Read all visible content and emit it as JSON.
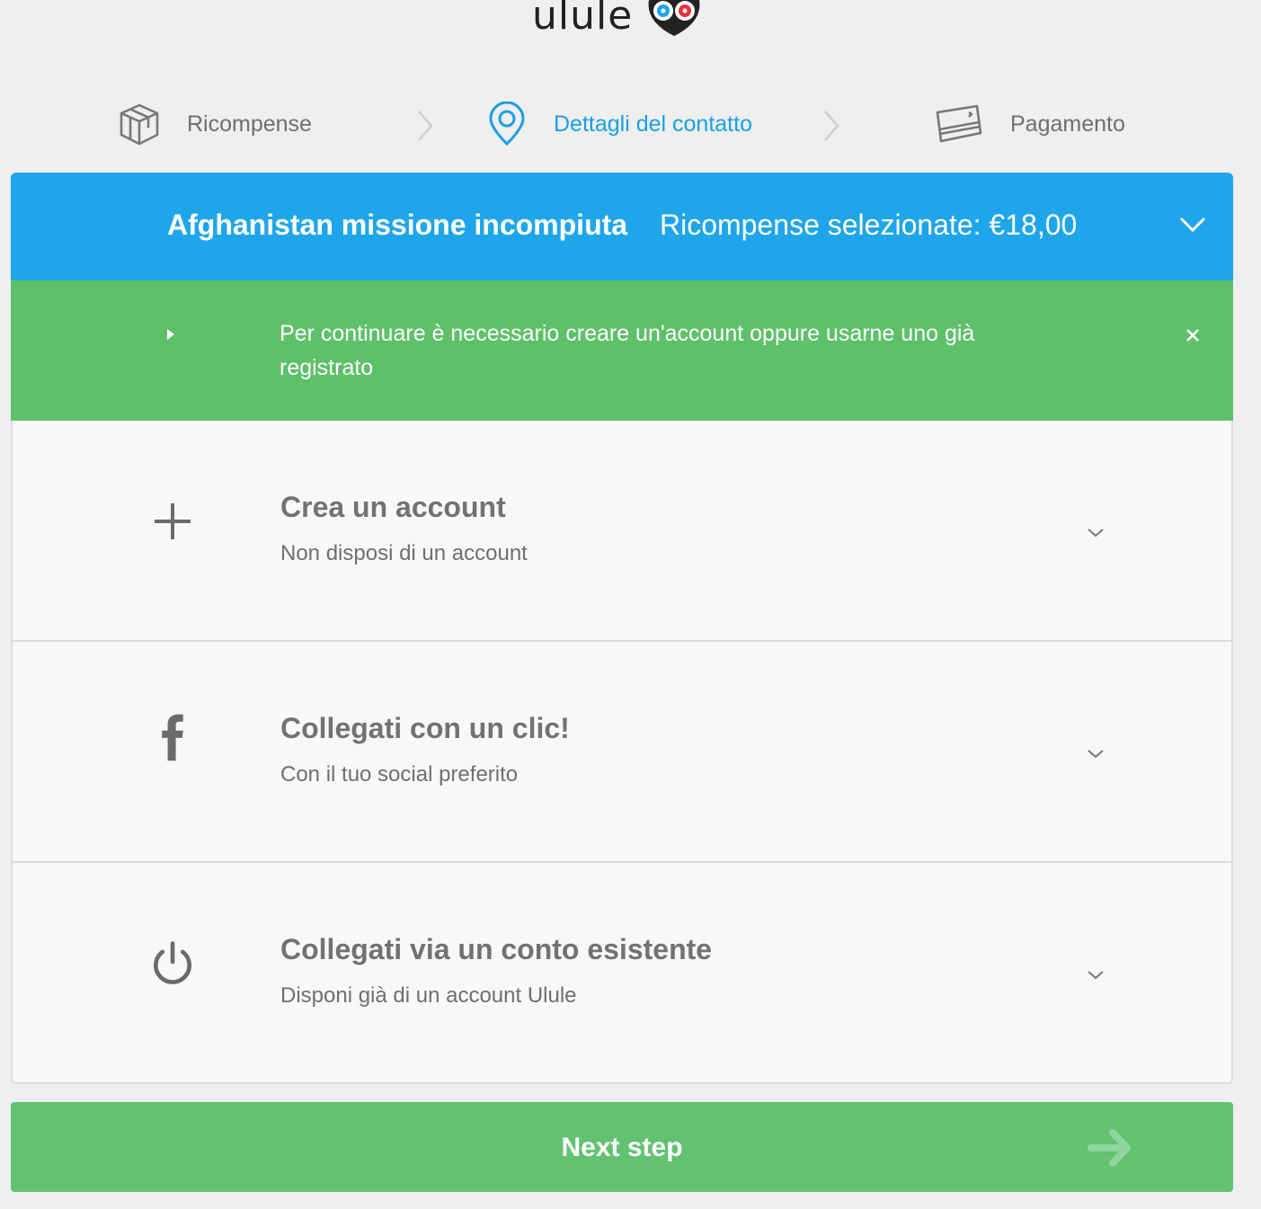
{
  "brand": {
    "name": "ulule"
  },
  "steps": [
    {
      "label": "Ricompense",
      "icon": "package-icon",
      "active": false
    },
    {
      "label": "Dettagli del contatto",
      "icon": "location-pin-icon",
      "active": true
    },
    {
      "label": "Pagamento",
      "icon": "credit-card-icon",
      "active": false
    }
  ],
  "banner": {
    "project_title": "Afghanistan missione incompiuta",
    "reward_summary": "Ricompense selezionate: €18,00"
  },
  "notice": {
    "text": "Per continuare è necessario creare un'account oppure usarne uno già registrato"
  },
  "options": [
    {
      "title": "Crea un account",
      "subtitle": "Non disposi di un account",
      "icon": "plus-icon"
    },
    {
      "title": "Collegati con un clic!",
      "subtitle": "Con il tuo social preferito",
      "icon": "facebook-icon"
    },
    {
      "title": "Collegati via un conto esistente",
      "subtitle": "Disponi già di un account Ulule",
      "icon": "power-icon"
    }
  ],
  "next_button": {
    "label": "Next step"
  },
  "colors": {
    "accent_blue": "#1fa6ea",
    "notice_green": "#5ec16a",
    "button_green": "#62c272",
    "active_step": "#1a9fe3"
  }
}
